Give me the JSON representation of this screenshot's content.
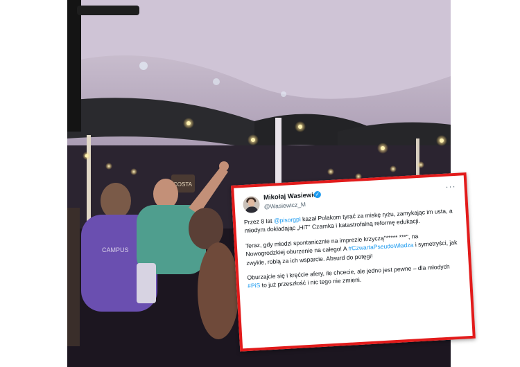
{
  "tweet": {
    "author_name": "Mikołaj Wasiewicz",
    "author_handle": "@Wasiewicz_M",
    "p1": {
      "a": "Przez 8 lat ",
      "mention": "@pisorgpl",
      "b": " kazał Polakom tyrać za miskę ryżu, zamykając im usta, a młodym dokładając „HiT” Czarnka i katastrofalną reformę edukacji."
    },
    "p2": {
      "a": "Teraz, gdy młodzi spontanicznie na imprezie krzyczą\"***** ***\", na Nowogrodzkiej oburzenie na całego! A ",
      "hashtag": "#CzwartaPseudoWładza",
      "b": " i symetryści, jak zwykle, robią za ich wsparcie. Absurd do potęgi!"
    },
    "p3": {
      "a": "Oburzajcie się i kręćcie afery, ile chcecie, ale jedno jest pewne – dla młodych ",
      "hashtag": "#PiS",
      "b": " to już przeszłość i nic tego nie zmieni."
    }
  },
  "scene": {
    "banner_text": "COSTA",
    "shirt_text": "CAMPUS"
  },
  "colors": {
    "card_border": "#e21b1b",
    "link": "#1d9bf0",
    "tent": "#c8bcd0"
  }
}
